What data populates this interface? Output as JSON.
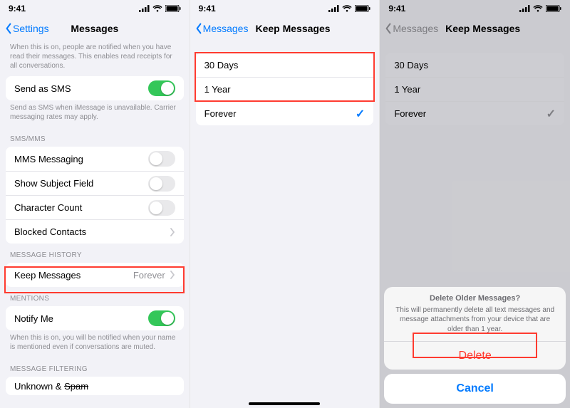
{
  "status": {
    "time": "9:41"
  },
  "screen1": {
    "back": "Settings",
    "title": "Messages",
    "note_read": "When this is on, people are notified when you have read their messages. This enables read receipts for all conversations.",
    "send_sms": "Send as SMS",
    "note_sms": "Send as SMS when iMessage is unavailable. Carrier messaging rates may apply.",
    "sec_smsmms": "SMS/MMS",
    "mms": "MMS Messaging",
    "subject": "Show Subject Field",
    "charcount": "Character Count",
    "blocked": "Blocked Contacts",
    "sec_history": "MESSAGE HISTORY",
    "keep": "Keep Messages",
    "keep_value": "Forever",
    "sec_mentions": "MENTIONS",
    "notify": "Notify Me",
    "note_notify": "When this is on, you will be notified when your name is mentioned even if conversations are muted.",
    "sec_filter": "MESSAGE FILTERING",
    "unknown": "Unknown & ",
    "spam": "Spam"
  },
  "screen2": {
    "back": "Messages",
    "title": "Keep Messages",
    "opt30": "30 Days",
    "opt1y": "1 Year",
    "optForever": "Forever"
  },
  "screen3": {
    "back": "Messages",
    "title": "Keep Messages",
    "opt30": "30 Days",
    "opt1y": "1 Year",
    "optForever": "Forever",
    "sheet_title": "Delete Older Messages?",
    "sheet_msg": "This will permanently delete all text messages and message attachments from your device that are older than 1 year.",
    "delete": "Delete",
    "cancel": "Cancel"
  }
}
